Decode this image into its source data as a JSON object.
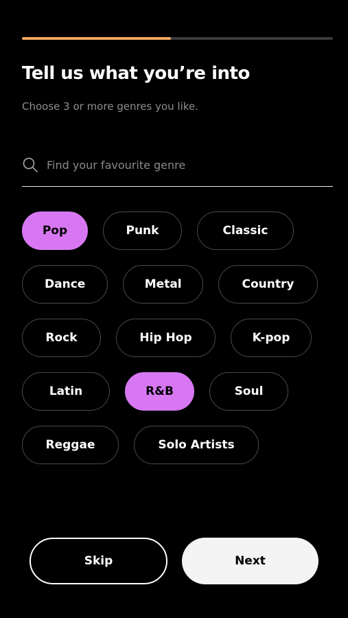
{
  "progress": {
    "fraction": 0.48,
    "fill_color": "#f2a85c",
    "track_color": "#3a3a3a"
  },
  "header": {
    "title": "Tell us what you’re into",
    "subtitle": "Choose 3 or more genres you like."
  },
  "search": {
    "placeholder": "Find your favourite genre",
    "value": "",
    "icon": "search-icon"
  },
  "genres": {
    "selected_color": "#d778f2",
    "items": [
      {
        "label": "Pop",
        "selected": true
      },
      {
        "label": "Punk",
        "selected": false
      },
      {
        "label": "Classic",
        "selected": false
      },
      {
        "label": "Dance",
        "selected": false
      },
      {
        "label": "Metal",
        "selected": false
      },
      {
        "label": "Country",
        "selected": false
      },
      {
        "label": "Rock",
        "selected": false
      },
      {
        "label": "Hip Hop",
        "selected": false
      },
      {
        "label": "K-pop",
        "selected": false
      },
      {
        "label": "Latin",
        "selected": false
      },
      {
        "label": "R&B",
        "selected": true
      },
      {
        "label": "Soul",
        "selected": false
      },
      {
        "label": "Reggae",
        "selected": false
      },
      {
        "label": "Solo Artists",
        "selected": false
      }
    ]
  },
  "actions": {
    "skip_label": "Skip",
    "next_label": "Next"
  }
}
